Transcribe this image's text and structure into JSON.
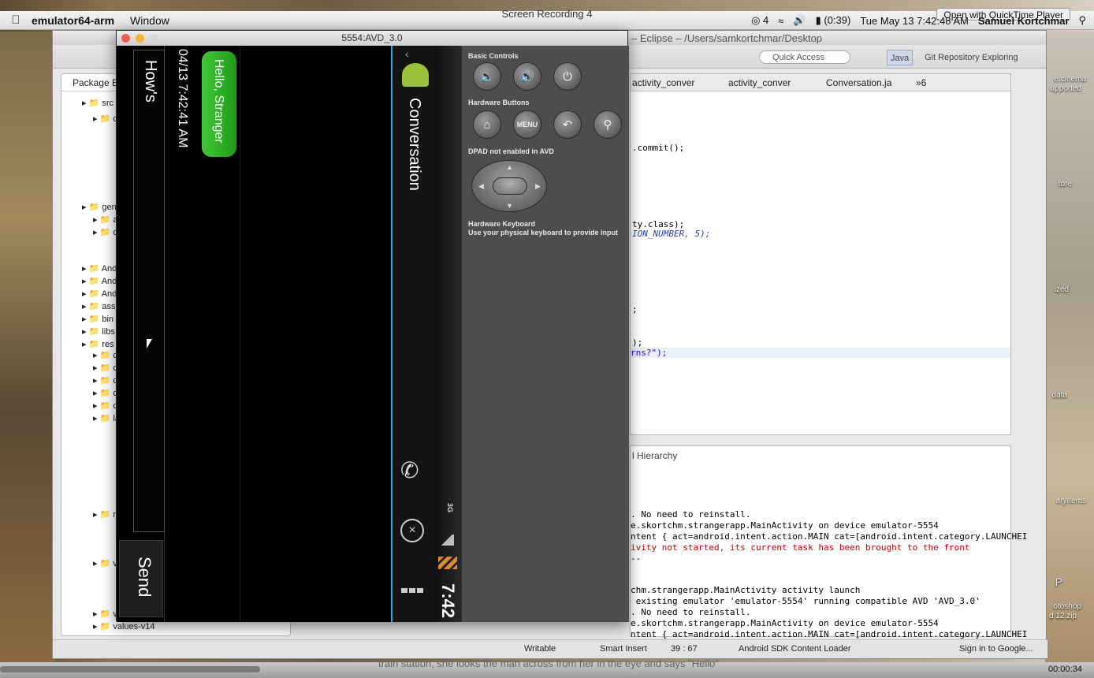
{
  "recording": {
    "title": "Screen Recording 4",
    "open_with": "Open with QuickTime Player",
    "elapsed": "00:00:34",
    "progress": 0.25
  },
  "menubar": {
    "app": "emulator64-arm",
    "menu_window": "Window",
    "battery": "(0:39)",
    "datetime": "Tue May 13  7:42:48 AM",
    "user": "Samuel Kortchmar",
    "badge": "4"
  },
  "desktop": {
    "labels": [
      "e.cinema",
      "upported",
      "tore",
      "ized",
      "data",
      "aryItems",
      "otoshop",
      "d 12.zip",
      "P"
    ]
  },
  "eclipse": {
    "title": "– Eclipse – /Users/samkortchmar/Desktop",
    "quick_access": "Quick Access",
    "perspective_java": "Java",
    "perspective_git": "Git Repository Exploring",
    "package_tab": "Package E",
    "tree": [
      "src",
      "c",
      "gen",
      "a",
      "c",
      "And",
      "And",
      "And",
      "asse",
      "bin",
      "libs",
      "res",
      "d",
      "d",
      "d",
      "d",
      "d",
      "la",
      "m",
      "v",
      "v",
      "values-v14"
    ],
    "editor_tabs": [
      "activity_conver",
      "activity_conver",
      "Conversation.ja",
      "»6"
    ],
    "code_lines": [
      ".commit();",
      "ty.class);",
      "ION_NUMBER, 5);",
      ";",
      ");",
      "rns?\");"
    ],
    "console_title": "l Hierarchy",
    "console_lines": [
      {
        "text": ". No need to reinstall.",
        "color": "#000000"
      },
      {
        "text": "e.skortchm.strangerapp.MainActivity on device emulator-5554",
        "color": "#000000"
      },
      {
        "text": "ntent { act=android.intent.action.MAIN cat=[android.intent.category.LAUNCHEI",
        "color": "#000000"
      },
      {
        "text": "ivity not started, its current task has been brought to the front",
        "color": "#cc0000"
      },
      {
        "text": "--",
        "color": "#000000"
      },
      {
        "text": "chm.strangerapp.MainActivity activity launch",
        "color": "#000000"
      },
      {
        "text": " existing emulator 'emulator-5554' running compatible AVD 'AVD_3.0'",
        "color": "#000000"
      },
      {
        "text": ". No need to reinstall.",
        "color": "#000000"
      },
      {
        "text": "e.skortchm.strangerapp.MainActivity on device emulator-5554",
        "color": "#000000"
      },
      {
        "text": "ntent { act=android.intent.action.MAIN cat=[android.intent.category.LAUNCHEI",
        "color": "#000000"
      },
      {
        "text": "ivity not started, its current task has been brought to the front",
        "color": "#cc0000"
      }
    ],
    "status": {
      "writable": "Writable",
      "insert": "Smart Insert",
      "position": "39 : 67",
      "loader": "Android SDK Content Loader",
      "sign_in": "Sign in to Google..."
    }
  },
  "emulator": {
    "title": "5554:AVD_3.0",
    "controls": {
      "basic": "Basic Controls",
      "hardware_buttons": "Hardware Buttons",
      "menu_label": "MENU",
      "dpad": "DPAD not enabled in AVD",
      "keyboard": "Hardware Keyboard",
      "keyboard_hint": "Use your physical keyboard to provide input"
    },
    "app": {
      "title": "Conversation",
      "message": "Hello, Stranger",
      "timestamp": "04/13 7:42:41 AM",
      "input_text": "How's",
      "send": "Send",
      "clock": "7:42",
      "network": "3G"
    }
  },
  "caption": "train station, she looks the man across from her in the eye and says \"Hello\""
}
